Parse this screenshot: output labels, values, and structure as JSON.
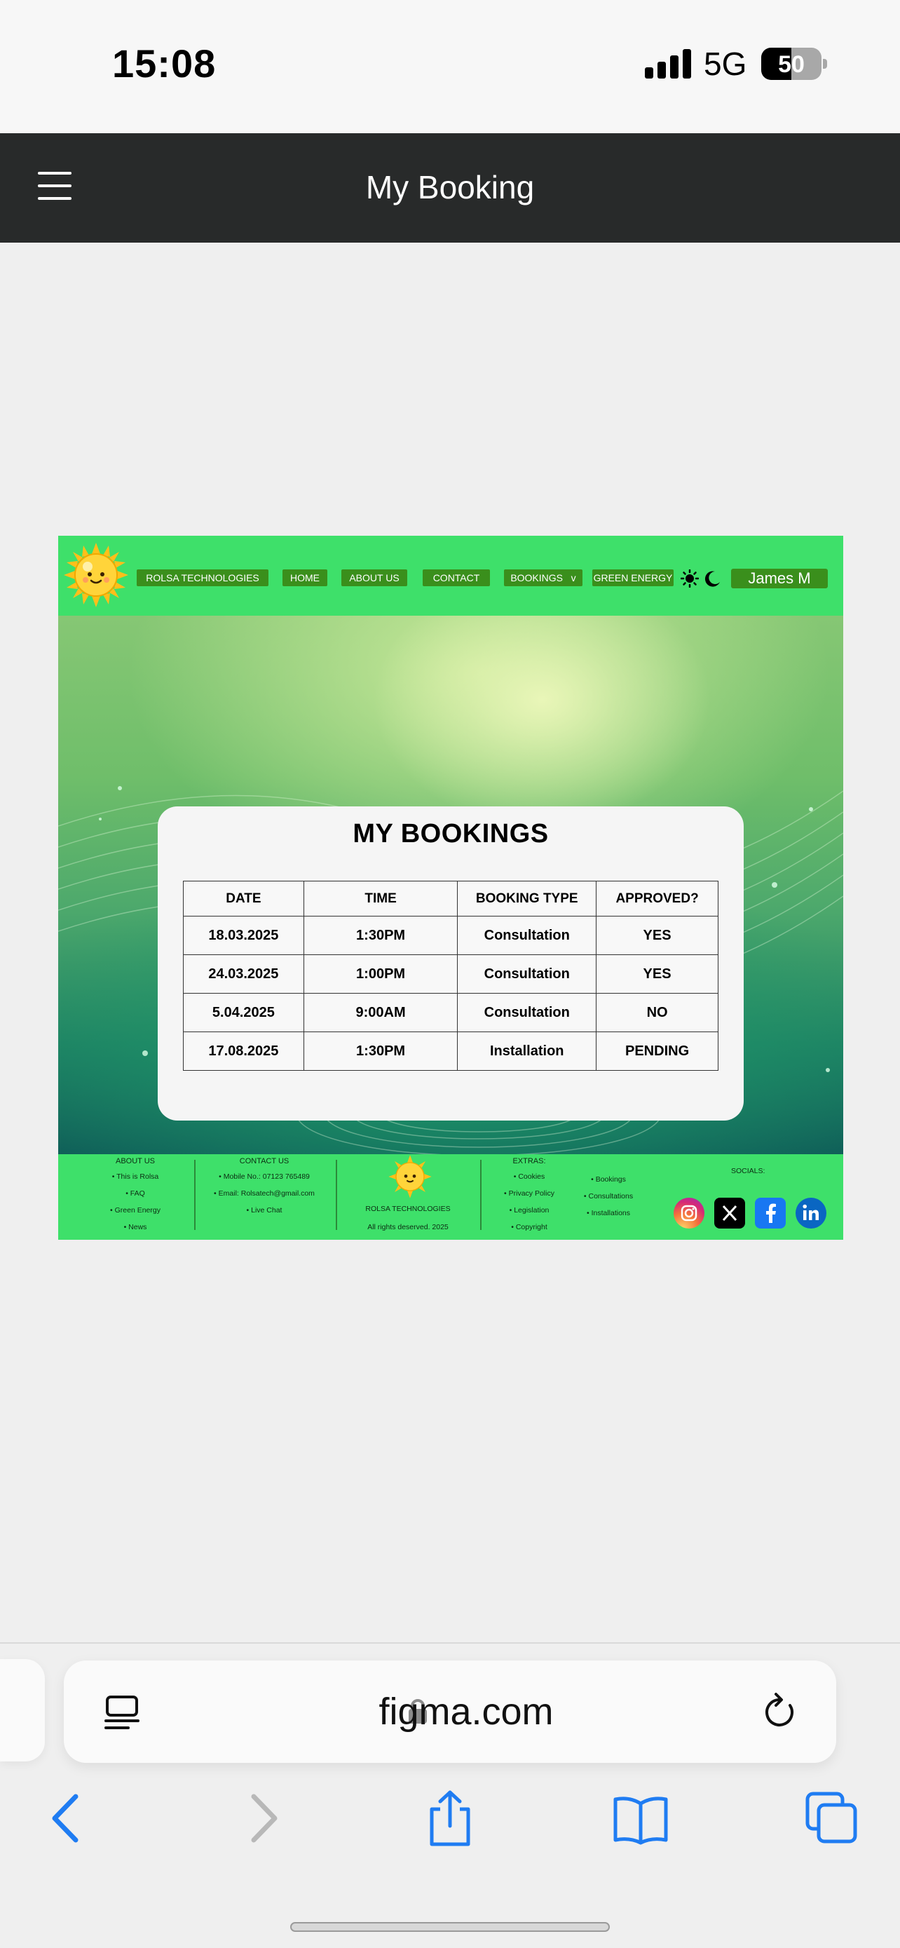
{
  "status_bar": {
    "time": "15:08",
    "network": "5G",
    "battery": "50"
  },
  "app_header": {
    "title": "My Booking"
  },
  "site_nav": {
    "items": [
      "ROLSA TECHNOLOGIES",
      "HOME",
      "ABOUT US",
      "CONTACT",
      "BOOKINGS   v",
      "GREEN ENERGY"
    ],
    "user": "James M"
  },
  "bookings": {
    "title": "MY BOOKINGS",
    "columns": [
      "DATE",
      "TIME",
      "BOOKING TYPE",
      "APPROVED?"
    ],
    "rows": [
      [
        "18.03.2025",
        "1:30PM",
        "Consultation",
        "YES"
      ],
      [
        "24.03.2025",
        "1:00PM",
        "Consultation",
        "YES"
      ],
      [
        "5.04.2025",
        "9:00AM",
        "Consultation",
        "NO"
      ],
      [
        "17.08.2025",
        "1:30PM",
        "Installation",
        "PENDING"
      ]
    ]
  },
  "footer": {
    "about": {
      "heading": "ABOUT US",
      "items": [
        "This is Rolsa",
        "FAQ",
        "Green Energy",
        "News"
      ]
    },
    "contact": {
      "heading": "CONTACT US",
      "items": [
        "Mobile No.: 07123 765489",
        "Email: Rolsatech@gmail.com",
        "Live Chat"
      ]
    },
    "brand": {
      "name": "ROLSA TECHNOLOGIES",
      "rights": "All rights deserved. 2025"
    },
    "extras": {
      "heading": "EXTRAS:",
      "col1": [
        "Cookies",
        "Privacy Policy",
        "Legislation",
        "Copyright"
      ],
      "col2": [
        "Bookings",
        "Consultations",
        "Installations"
      ]
    },
    "socials": {
      "heading": "SOCIALS:",
      "icons": [
        "instagram-icon",
        "x-icon",
        "facebook-icon",
        "linkedin-icon"
      ]
    }
  },
  "browser": {
    "url": "figma.com"
  },
  "colors": {
    "nav_green": "#3ee06a",
    "pill_green": "#3a8f1c",
    "header_dark": "#282a2a",
    "ios_blue": "#1f7cf2"
  }
}
